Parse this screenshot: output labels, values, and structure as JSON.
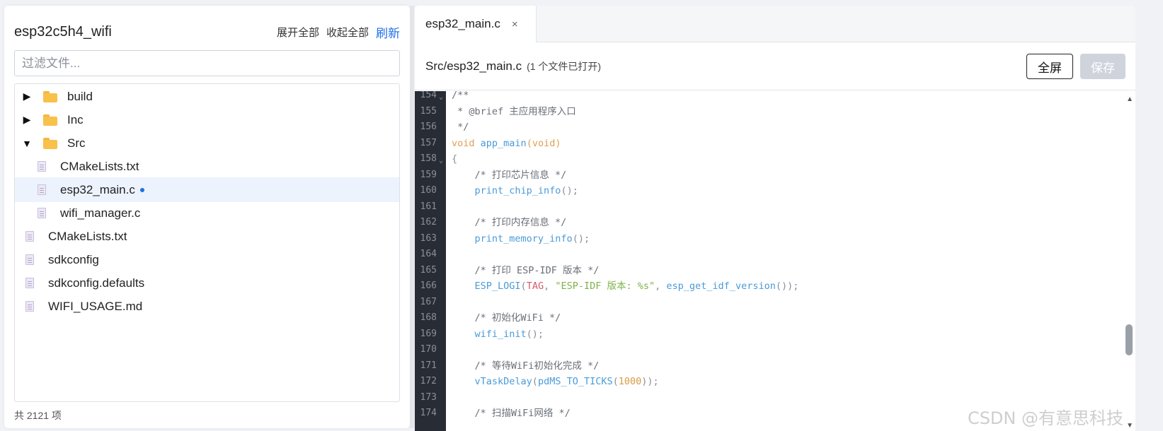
{
  "sidebar": {
    "project_name": "esp32c5h4_wifi",
    "expand_all": "展开全部",
    "collapse_all": "收起全部",
    "refresh": "刷新",
    "filter_placeholder": "过滤文件...",
    "items": [
      {
        "label": "build",
        "kind": "folder",
        "expanded": false
      },
      {
        "label": "Inc",
        "kind": "folder",
        "expanded": false
      },
      {
        "label": "Src",
        "kind": "folder",
        "expanded": true
      },
      {
        "label": "CMakeLists.txt",
        "kind": "file"
      },
      {
        "label": "esp32_main.c",
        "kind": "file",
        "selected": true,
        "modified": true
      },
      {
        "label": "wifi_manager.c",
        "kind": "file"
      },
      {
        "label": "CMakeLists.txt",
        "kind": "file"
      },
      {
        "label": "sdkconfig",
        "kind": "file"
      },
      {
        "label": "sdkconfig.defaults",
        "kind": "file"
      },
      {
        "label": "WIFI_USAGE.md",
        "kind": "file"
      }
    ],
    "item_count": "共 2121 项"
  },
  "editor": {
    "tab_label": "esp32_main.c",
    "tab_close": "×",
    "file_path": "Src/esp32_main.c",
    "open_count": "(1 个文件已打开)",
    "fullscreen_label": "全屏",
    "save_label": "保存",
    "line_numbers": [
      "154",
      "155",
      "156",
      "157",
      "158",
      "159",
      "160",
      "161",
      "162",
      "163",
      "164",
      "165",
      "166",
      "167",
      "168",
      "169",
      "170",
      "171",
      "172",
      "173",
      "174"
    ]
  },
  "watermark": "CSDN @有意思科技",
  "colors": {
    "accent": "#1e6fe8",
    "gutter_bg": "#282c34",
    "selected_row": "#ecf3fd"
  }
}
